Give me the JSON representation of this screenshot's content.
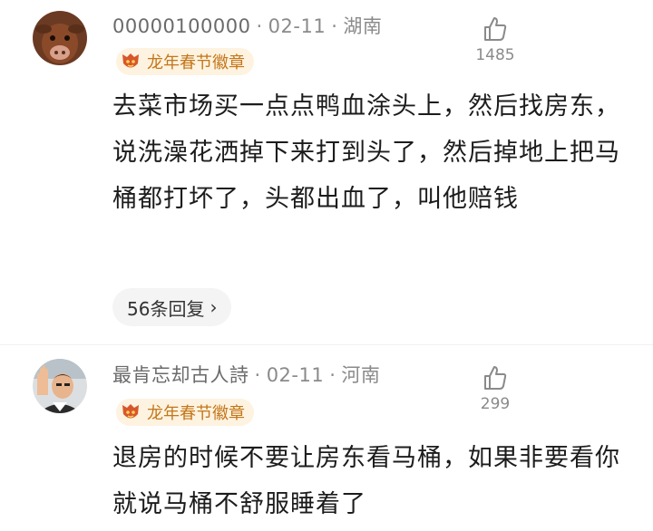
{
  "comments": [
    {
      "username": "00000100000",
      "date": "02-11",
      "location": "湖南",
      "badge": "龙年春节徽章",
      "likes": "1485",
      "text": "去菜市场买一点点鸭血涂头上，然后找房东，说洗澡花洒掉下来打到头了，然后掉地上把马桶都打坏了，头都出血了，叫他赔钱",
      "replies": "56条回复"
    },
    {
      "username": "最肯忘却古人詩",
      "date": "02-11",
      "location": "河南",
      "badge": "龙年春节徽章",
      "likes": "299",
      "text": "退房的时候不要让房东看马桶，如果非要看你就说马桶不舒服睡着了"
    }
  ],
  "ui": {
    "separator": "·",
    "chevron": "›"
  },
  "icons": {
    "like": "thumbs-up-icon",
    "badge": "dragon-badge-icon",
    "avatar1": "cow-avatar",
    "avatar2": "man-waving-avatar"
  },
  "colors": {
    "meta": "#8a8a8a",
    "badge_bg": "#fdf3e0",
    "badge_text": "#c4761a",
    "pill_bg": "#f4f4f4"
  }
}
